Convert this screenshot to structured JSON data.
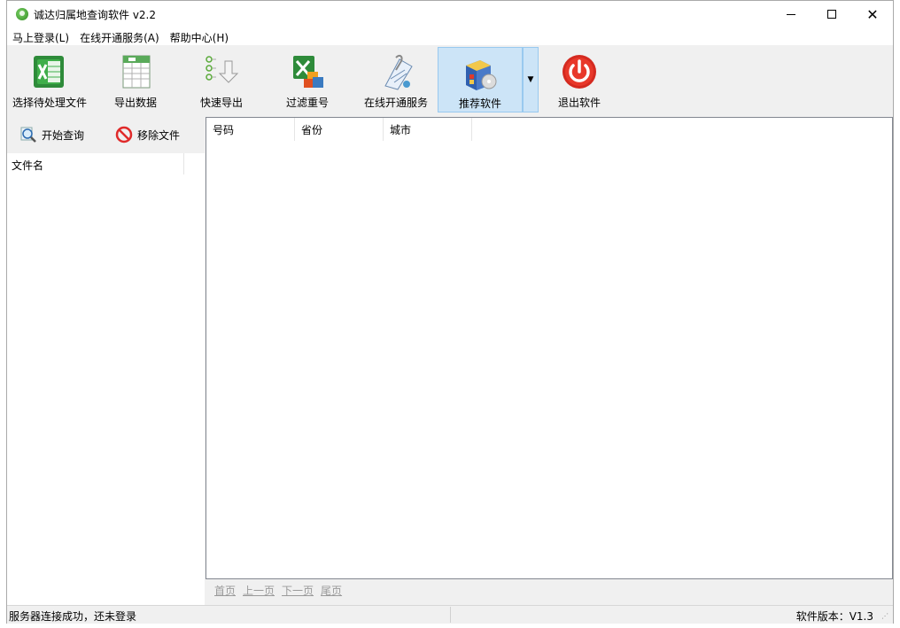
{
  "window": {
    "title": "诚达归属地查询软件 v2.2",
    "controls": {
      "minimize": "minimize",
      "maximize": "maximize",
      "close": "✕"
    }
  },
  "menu": [
    "马上登录(L)",
    "在线开通服务(A)",
    "帮助中心(H)"
  ],
  "toolbar": {
    "items": [
      {
        "label": "选择待处理文件",
        "icon": "excel-open-icon"
      },
      {
        "label": "导出数据",
        "icon": "spreadsheet-export-icon"
      },
      {
        "label": "快速导出",
        "icon": "quick-export-icon"
      },
      {
        "label": "过滤重号",
        "icon": "filter-duplicates-icon"
      },
      {
        "label": "在线开通服务",
        "icon": "online-service-icon"
      },
      {
        "label": "推荐软件",
        "icon": "software-box-icon",
        "active": true
      },
      {
        "label": "退出软件",
        "icon": "power-icon"
      }
    ]
  },
  "left_actions": {
    "start_query": "开始查询",
    "remove_file": "移除文件"
  },
  "file_list": {
    "column": "文件名"
  },
  "result_table": {
    "columns": [
      "号码",
      "省份",
      "城市"
    ],
    "rows": []
  },
  "pager": [
    "首页",
    "上一页",
    "下一页",
    "尾页"
  ],
  "status": {
    "left": "服务器连接成功，还未登录",
    "right": "软件版本：V1.3"
  },
  "colors": {
    "active_tool_bg": "#cce4f7",
    "active_tool_border": "#99c9ef",
    "pager_text": "#9a9a9a"
  }
}
